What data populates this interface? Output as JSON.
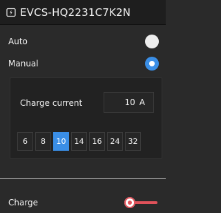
{
  "header": {
    "title": "EVCS-HQ2231C7K2N",
    "icon": "ev-charger-icon"
  },
  "mode": {
    "auto_label": "Auto",
    "manual_label": "Manual",
    "selected": "Manual"
  },
  "charge_current": {
    "label": "Charge current",
    "value": "10",
    "unit": "A",
    "presets": [
      "6",
      "8",
      "10",
      "14",
      "16",
      "24",
      "32"
    ],
    "selected_preset": "10"
  },
  "charge": {
    "label": "Charge",
    "enabled": false
  },
  "colors": {
    "accent": "#3a8ee6",
    "toggle_off": "#e0525a"
  }
}
